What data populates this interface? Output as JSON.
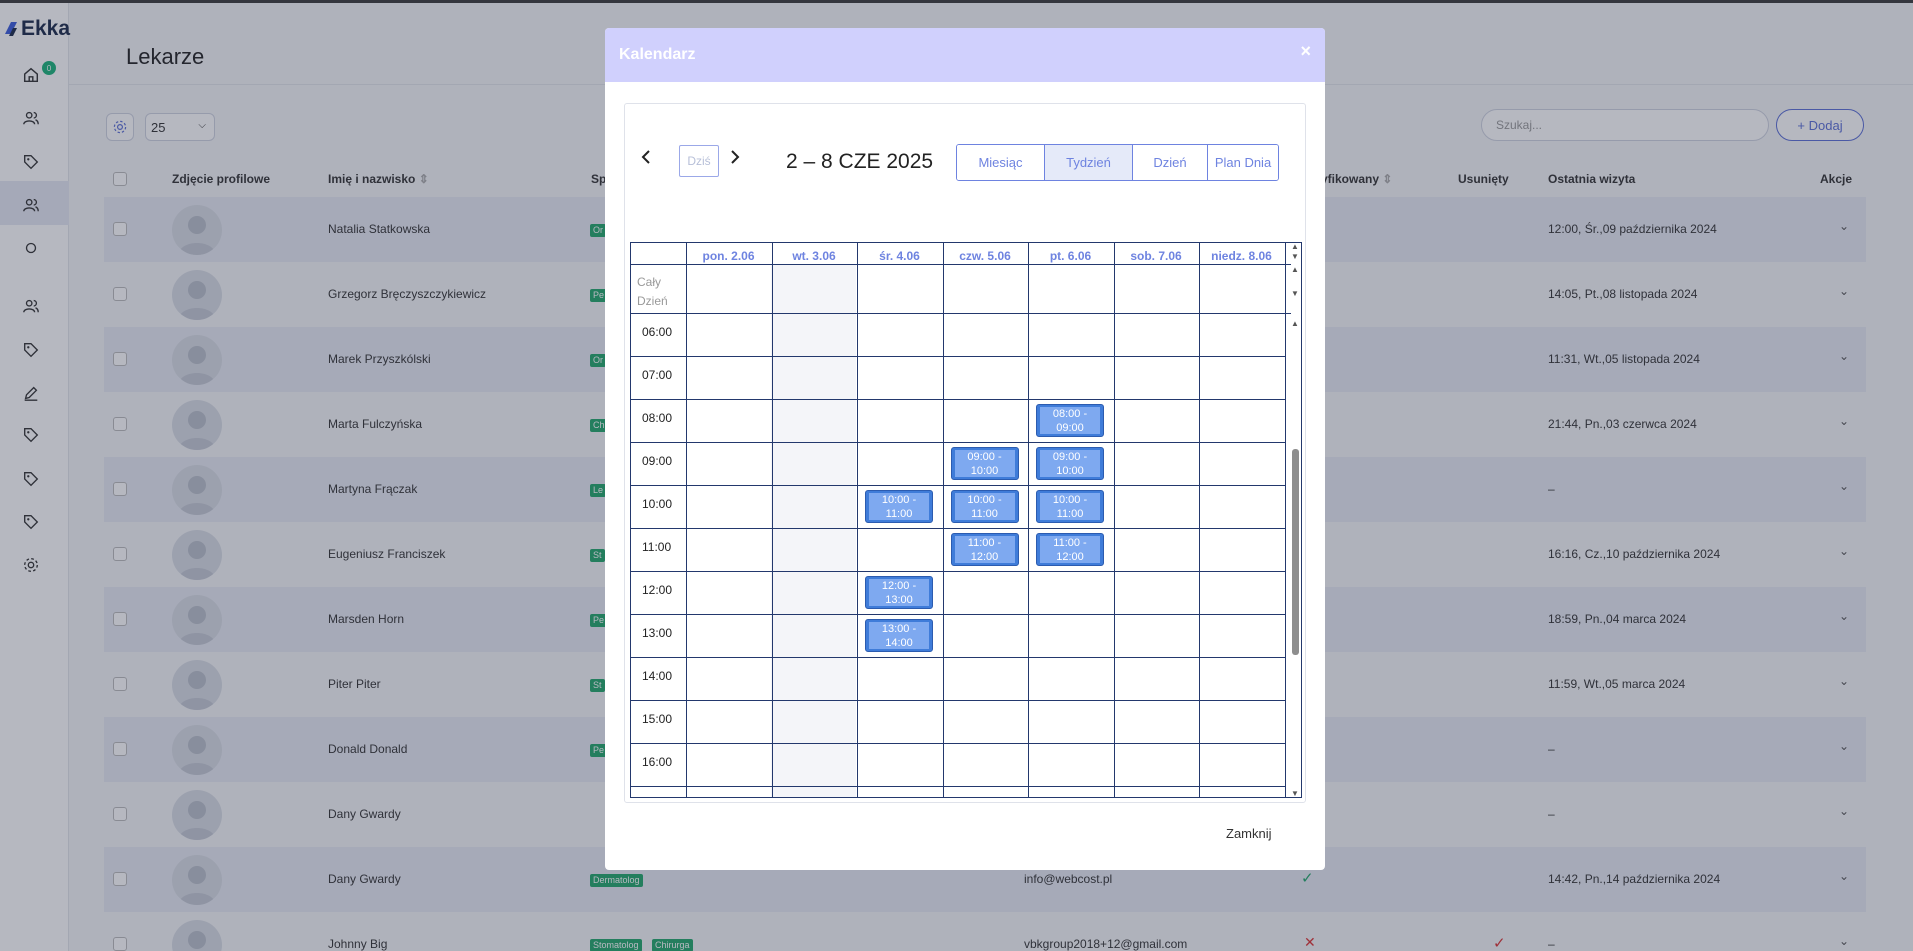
{
  "app": {
    "logo_text": "Ekka",
    "home_badge": "0"
  },
  "page": {
    "title": "Lekarze"
  },
  "toolbar": {
    "per_page": "25",
    "search_placeholder": "Szukaj...",
    "add_label": "+ Dodaj"
  },
  "table": {
    "headers": {
      "photo": "Zdjęcie profilowe",
      "name": "Imię i nazwisko",
      "spec": "Sp",
      "verified": "yfikowany",
      "deleted": "Usunięty",
      "last_visit": "Ostatnia wizyta",
      "actions": "Akcje"
    },
    "rows": [
      {
        "name": "Natalia Statkowska",
        "tag": "Or",
        "last_visit": "12:00, Śr.,09 października 2024"
      },
      {
        "name": "Grzegorz Bręczyszczykiewicz",
        "tag": "Pe",
        "last_visit": "14:05, Pt.,08 listopada 2024"
      },
      {
        "name": "Marek Przyszkólski",
        "tag": "Or",
        "last_visit": "11:31, Wt.,05 listopada 2024"
      },
      {
        "name": "Marta Fulczyńska",
        "tag": "Ch",
        "last_visit": "21:44, Pn.,03 czerwca 2024"
      },
      {
        "name": "Martyna Frączak",
        "tag": "Le",
        "last_visit": "–"
      },
      {
        "name": "Eugeniusz Franciszek",
        "tag": "St",
        "last_visit": "16:16, Cz.,10 października 2024"
      },
      {
        "name": "Marsden Horn",
        "tag": "Pe",
        "last_visit": "18:59, Pn.,04 marca 2024"
      },
      {
        "name": "Piter Piter",
        "tag": "St",
        "last_visit": "11:59, Wt.,05 marca 2024"
      },
      {
        "name": "Donald Donald",
        "tag": "Pe",
        "last_visit": "–"
      },
      {
        "name": "Dany Gwardy",
        "tag": "",
        "last_visit": "–"
      },
      {
        "name": "Dany Gwardy",
        "tag": "Dermatolog",
        "email": "info@webcost.pl",
        "last_visit": "14:42, Pn.,14 października 2024"
      },
      {
        "name": "Johnny Big",
        "tag": "Stomatolog",
        "tag2": "Chirurga",
        "email": "vbkgroup2018+12@gmail.com",
        "last_visit": "–"
      }
    ]
  },
  "modal": {
    "title": "Kalendarz",
    "close_x": "×",
    "footer_close": "Zamknij",
    "calendar": {
      "today_label": "Dziś",
      "range": "2 – 8 CZE 2025",
      "views": [
        "Miesiąc",
        "Tydzień",
        "Dzień",
        "Plan Dnia"
      ],
      "active_view": "Tydzień",
      "days": [
        "pon. 2.06",
        "wt. 3.06",
        "śr. 4.06",
        "czw. 5.06",
        "pt. 6.06",
        "sob. 7.06",
        "niedz. 8.06"
      ],
      "all_day_label_1": "Cały",
      "all_day_label_2": "Dzień",
      "hours": [
        "06:00",
        "07:00",
        "08:00",
        "09:00",
        "10:00",
        "11:00",
        "12:00",
        "13:00",
        "14:00",
        "15:00",
        "16:00"
      ],
      "events": [
        {
          "day": 4,
          "start": 2,
          "label_1": "08:00 -",
          "label_2": "09:00"
        },
        {
          "day": 3,
          "start": 3,
          "label_1": "09:00 -",
          "label_2": "10:00"
        },
        {
          "day": 4,
          "start": 3,
          "label_1": "09:00 -",
          "label_2": "10:00"
        },
        {
          "day": 2,
          "start": 4,
          "label_1": "10:00 -",
          "label_2": "11:00"
        },
        {
          "day": 3,
          "start": 4,
          "label_1": "10:00 -",
          "label_2": "11:00"
        },
        {
          "day": 4,
          "start": 4,
          "label_1": "10:00 -",
          "label_2": "11:00"
        },
        {
          "day": 3,
          "start": 5,
          "label_1": "11:00 -",
          "label_2": "12:00"
        },
        {
          "day": 4,
          "start": 5,
          "label_1": "11:00 -",
          "label_2": "12:00"
        },
        {
          "day": 2,
          "start": 6,
          "label_1": "12:00 -",
          "label_2": "13:00"
        },
        {
          "day": 2,
          "start": 7,
          "label_1": "13:00 -",
          "label_2": "14:00"
        }
      ]
    }
  },
  "colors": {
    "accent": "#6e83e0",
    "event": "#3f7cd9",
    "header": "#d0d0fd",
    "tag": "#22a86b"
  }
}
